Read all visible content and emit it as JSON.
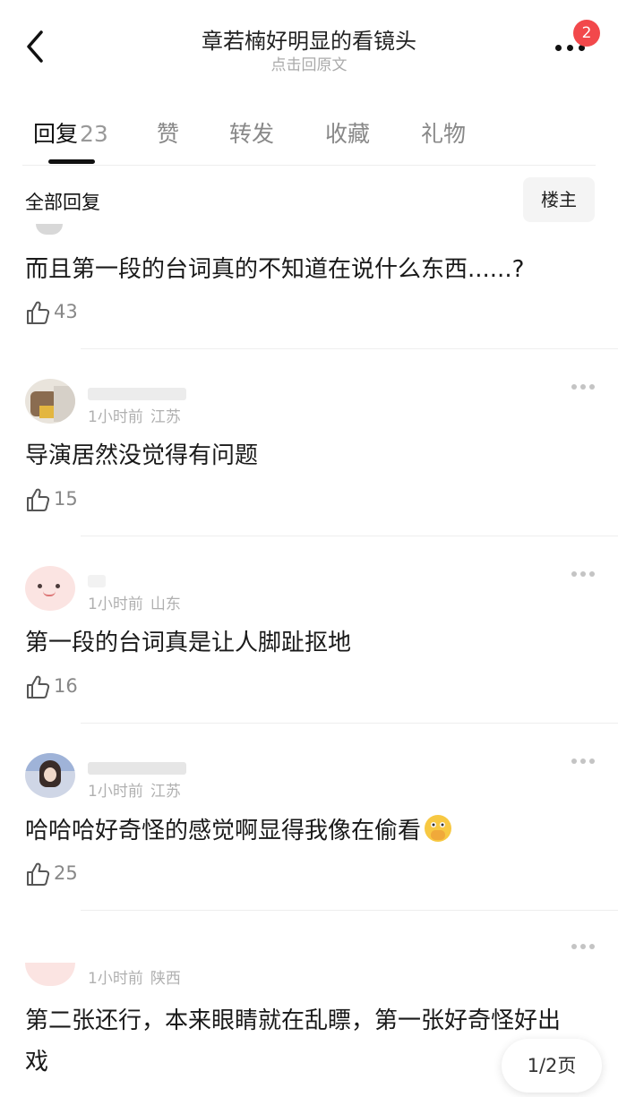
{
  "header": {
    "title": "章若楠好明显的看镜头",
    "subtitle": "点击回原文",
    "badge_count": "2"
  },
  "tabs": [
    {
      "label": "回复",
      "count": "23",
      "active": true
    },
    {
      "label": "赞"
    },
    {
      "label": "转发"
    },
    {
      "label": "收藏"
    },
    {
      "label": "礼物"
    }
  ],
  "section": {
    "title": "全部回复",
    "owner_button": "楼主"
  },
  "comments": [
    {
      "text": "而且第一段的台词真的不知道在说什么东西......?",
      "likes": "43"
    },
    {
      "time": "1小时前",
      "location": "江苏",
      "text": "导演居然没觉得有问题",
      "likes": "15"
    },
    {
      "time": "1小时前",
      "location": "山东",
      "text": "第一段的台词真是让人脚趾抠地",
      "likes": "16"
    },
    {
      "time": "1小时前",
      "location": "江苏",
      "text": "哈哈哈好奇怪的感觉啊显得我像在偷看",
      "emoji": "face-with-open-eyes-and-hand-over-mouth",
      "likes": "25"
    },
    {
      "time": "1小时前",
      "location": "陕西",
      "text": "第二张还行，本来眼睛就在乱瞟，第一张好奇怪好出戏"
    }
  ],
  "pager": {
    "label": "1/2页"
  },
  "colors": {
    "badge": "#f2484b",
    "muted_text": "#b0b0b0",
    "like_text": "#888888"
  }
}
